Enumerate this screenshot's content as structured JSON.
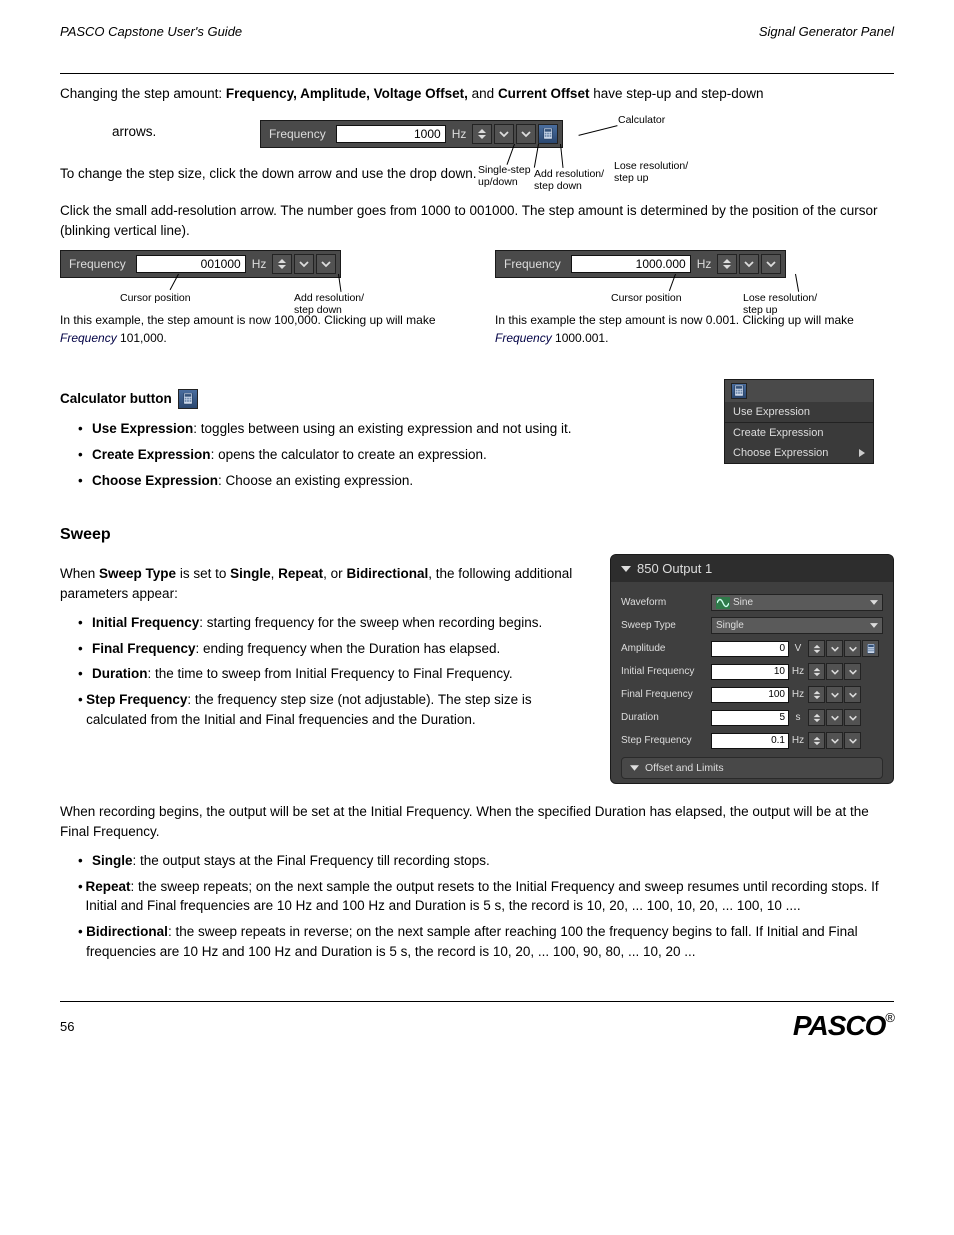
{
  "header": {
    "left": "PASCO Capstone User's Guide",
    "right": "Signal Generator Panel"
  },
  "intro": {
    "p1_a": "Changing the step amount: ",
    "p1_b": "Frequency, Amplitude, Voltage Offset,",
    "p1_c": " and ",
    "p1_d": "Current Offset",
    "p1_e": " have step-up and step-down",
    "arrows_text": "arrows.",
    "p1_f": " To change the step size, click the down arrow and use the drop down."
  },
  "callouts_main": {
    "c_updown": "Single-step\nup/down",
    "c_resup": "Add resolution/\nstep down",
    "c_resdn": "Lose resolution/\nstep up",
    "c_calc": "Calculator"
  },
  "freq_ctrl_main": {
    "label": "Frequency",
    "value": "1000",
    "unit": "Hz"
  },
  "freq_ctrl_left": {
    "label": "Frequency",
    "value": "001000",
    "unit": "Hz",
    "callout_cursor": "Cursor position",
    "callout_resbtn": "Add resolution/\nstep down"
  },
  "freq_ctrl_right": {
    "label": "Frequency",
    "value": "1000.000",
    "unit": "Hz",
    "callout_cursor": "Cursor position",
    "callout_resbtn": "Lose resolution/\nstep up"
  },
  "smallnote": {
    "text1": "In this example, the step amount is now 100,000. Clicking up will make",
    "text2": " Frequency",
    "text3": " 101,000.",
    "textr1": "In this example the step amount is now 0.001. Clicking up will make",
    "textr2": " Frequency",
    "textr3": " 1000.001."
  },
  "calc_section": {
    "title": "Calculator button ",
    "label_a": "Use Expression",
    "text1": ": toggles between using an existing expression and not using it.",
    "label_b": "Create Expression",
    "text2": ": opens the calculator to create an expression.",
    "label_c": "Choose Expression",
    "text3": ": Choose an existing expression."
  },
  "expr_menu": {
    "a": "Use Expression",
    "b": "Create Expression",
    "c": "Choose Expression"
  },
  "sweep_section": {
    "title": "Sweep",
    "p_a": "When",
    "p_b": " Sweep Type",
    "p_c": " is set to",
    "p_single": " Single",
    "p_repeat": " Repeat",
    "p_bidir": " Bidirectional",
    "p_d": ", the following additional parameters appear:",
    "or": ", or",
    "b_initf": "Initial Frequency",
    "b_initf_t": ": starting frequency for the sweep when recording begins.",
    "b_finalf": "Final Frequency",
    "b_finalf_t": ": ending frequency when the Duration has elapsed.",
    "b_dur": "Duration",
    "b_dur_t": ": the time to sweep from Initial Frequency to Final Frequency.",
    "b_step": "Step Frequency",
    "b_step_t": ": the frequency step size (not adjustable). The step size is calculated from the Initial and Final frequencies and the Duration."
  },
  "sweep_explain": {
    "p1_a": "When recording begins, the output will be set at the Initial Frequency. When the specified Duration has elapsed, the output will be at the Final Frequency.",
    "single_l": "Single",
    "single_t": ": the output stays at the Final Frequency till recording stops.",
    "repeat_l": "Repeat",
    "repeat_t": ": the sweep repeats; on the next sample the output resets to the Initial Frequency and sweep resumes until recording stops. If Initial and Final frequencies are 10 Hz and 100 Hz and Duration is 5 s, the record is 10, 20, ... 100, 10, 20, ... 100, 10 ....",
    "bidir_l": "Bidirectional",
    "bidir_t": ": the sweep repeats in reverse; on the next sample after reaching 100 the frequency begins to fall. If Initial and Final frequencies are 10 Hz and 100 Hz and Duration is 5 s, the record is 10, 20, ... 100, 90, 80, ... 10, 20 ..."
  },
  "panel": {
    "title": "850 Output 1",
    "rows": {
      "waveform": {
        "label": "Waveform",
        "value": "Sine"
      },
      "sweep": {
        "label": "Sweep Type",
        "value": "Single"
      },
      "amp": {
        "label": "Amplitude",
        "value": "0",
        "unit": "V"
      },
      "initf": {
        "label": "Initial Frequency",
        "value": "10",
        "unit": "Hz"
      },
      "finalf": {
        "label": "Final Frequency",
        "value": "100",
        "unit": "Hz"
      },
      "dur": {
        "label": "Duration",
        "value": "5",
        "unit": "s"
      },
      "stepf": {
        "label": "Step Frequency",
        "value": "0.1",
        "unit": "Hz"
      }
    },
    "offset_label": "Offset and Limits"
  },
  "footer": {
    "page": "56",
    "brand": "PASCO"
  },
  "icons": {
    "updown": "updown",
    "chevdown": "chevdown",
    "calc": "calc",
    "tri": "tri",
    "play": "play"
  }
}
